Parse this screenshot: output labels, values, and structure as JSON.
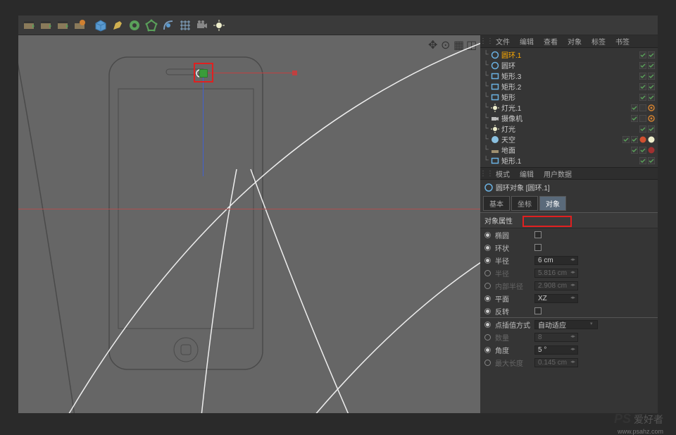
{
  "toolbar": {
    "icons": [
      "clapper1",
      "clapper2",
      "clapper3",
      "clapper-gear",
      "cube",
      "pen",
      "gear-green",
      "poly-icon",
      "arc-icon",
      "grid-icon",
      "camera-icon",
      "light-icon"
    ]
  },
  "viewport": {
    "corner_icons": [
      "move-icon",
      "magnet-icon",
      "grid-toggle-icon",
      "axis-icon"
    ]
  },
  "panel": {
    "tabs": [
      "文件",
      "编辑",
      "查看",
      "对象",
      "标签",
      "书签"
    ],
    "objects": [
      {
        "name": "圆环.1",
        "icon": "circle",
        "selected": true,
        "vis": [
          "on",
          "on"
        ]
      },
      {
        "name": "圆环",
        "icon": "circle",
        "vis": [
          "on",
          "on"
        ]
      },
      {
        "name": "矩形.3",
        "icon": "rect",
        "vis": [
          "on",
          "on"
        ]
      },
      {
        "name": "矩形.2",
        "icon": "rect",
        "vis": [
          "on",
          "on"
        ]
      },
      {
        "name": "矩形",
        "icon": "rect",
        "vis": [
          "on",
          "on"
        ]
      },
      {
        "name": "灯光.1",
        "icon": "light",
        "vis": [
          "on",
          "off"
        ],
        "extra": [
          "target"
        ]
      },
      {
        "name": "摄像机",
        "icon": "camera",
        "vis": [
          "on",
          "off"
        ],
        "extra": [
          "target"
        ]
      },
      {
        "name": "灯光",
        "icon": "light",
        "vis": [
          "on",
          "on"
        ]
      },
      {
        "name": "天空",
        "icon": "sky",
        "vis": [
          "on",
          "on"
        ],
        "extra": [
          "mat1",
          "mat2"
        ]
      },
      {
        "name": "地面",
        "icon": "floor",
        "vis": [
          "on",
          "on"
        ],
        "extra": [
          "mat3"
        ]
      },
      {
        "name": "矩形.1",
        "icon": "rect",
        "vis": [
          "on",
          "on"
        ]
      }
    ]
  },
  "attr": {
    "header_tabs": [
      "模式",
      "编辑",
      "用户数据"
    ],
    "title": "圆环对象 [圆环.1]",
    "subtabs": [
      "基本",
      "坐标",
      "对象"
    ],
    "section_title": "对象属性",
    "rows": [
      {
        "label": "椭圆",
        "type": "check"
      },
      {
        "label": "环状",
        "type": "check"
      },
      {
        "label": "半径",
        "type": "input",
        "value": "6 cm",
        "highlight": true
      },
      {
        "label": "半径",
        "type": "input",
        "value": "5.816 cm",
        "dim": true
      },
      {
        "label": "内部半径",
        "type": "input",
        "value": "2.908 cm",
        "dim": true
      },
      {
        "label": "平面",
        "type": "input",
        "value": "XZ"
      },
      {
        "label": "反转",
        "type": "check"
      }
    ],
    "interp_title": "点插值方式",
    "interp_value": "自动适应",
    "interp_rows": [
      {
        "label": "数量",
        "value": "8",
        "dim": true
      },
      {
        "label": "角度",
        "value": "5 °"
      },
      {
        "label": "最大长度",
        "value": "0.145 cm",
        "dim": true
      }
    ]
  },
  "watermark": {
    "logo": "PS",
    "text": "爱好者",
    "url": "www.psahz.com"
  }
}
